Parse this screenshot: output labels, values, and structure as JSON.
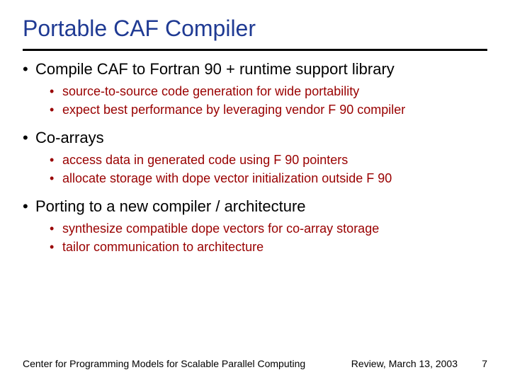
{
  "title": "Portable CAF Compiler",
  "bullets": {
    "b1_0": "Compile CAF to Fortran 90 + runtime support library",
    "b2_0": "source-to-source code generation for wide portability",
    "b2_1": "expect best performance by leveraging vendor F 90 compiler",
    "b1_1": "Co-arrays",
    "b2_2": "access data in generated code using F 90 pointers",
    "b2_3": "allocate storage with dope vector initialization outside F 90",
    "b1_2": "Porting to a new compiler / architecture",
    "b2_4": "synthesize compatible dope vectors for co-array storage",
    "b2_5": "tailor communication to architecture"
  },
  "footer": {
    "left": "Center for Programming Models for Scalable Parallel Computing",
    "review": "Review, March 13, 2003",
    "page": "7"
  }
}
